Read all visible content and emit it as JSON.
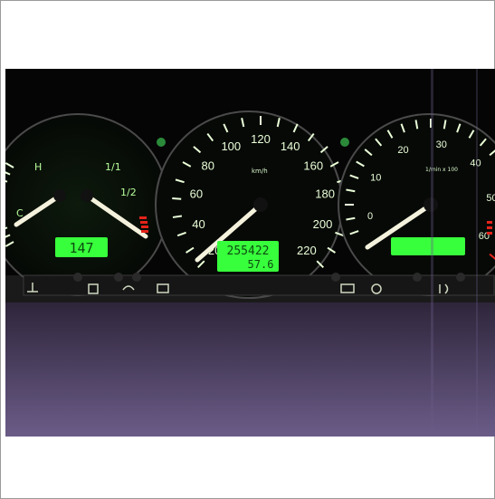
{
  "photo": {
    "subject": "car instrument cluster dashboard",
    "colors": {
      "backlight": "#7CFF6A",
      "lcd": "#38ff3c",
      "needle": "#f4f2dc",
      "redline": "#e5231b",
      "panel": "#0b0b0b"
    }
  },
  "left_gauges": {
    "temp_hot": "H",
    "temp_cold": "C",
    "fuel_full": "1/1",
    "fuel_half": "1/2",
    "lcd_value": "147"
  },
  "speedometer": {
    "unit": "km/h",
    "ticks": [
      "20",
      "40",
      "60",
      "80",
      "100",
      "120",
      "140",
      "160",
      "180",
      "200",
      "220"
    ],
    "odometer": "255422",
    "trip": "57.6"
  },
  "tachometer": {
    "unit": "1/min x 100",
    "ticks": [
      "0",
      "10",
      "20",
      "30",
      "40",
      "50",
      "60"
    ]
  }
}
